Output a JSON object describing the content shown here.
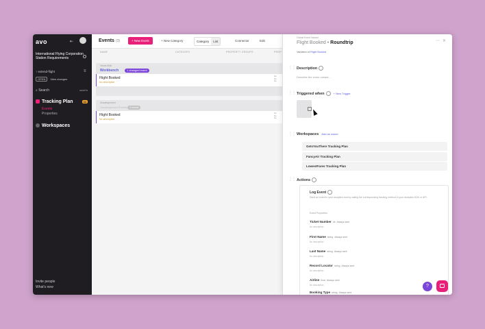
{
  "sidebar": {
    "logo": "avo",
    "workspace_name": "International Flying Corporation Station Requirements",
    "branch": "↑ extend-flight",
    "branch_tags": [
      "OPEN",
      "View changes"
    ],
    "search": "Search",
    "search_kbd": "cmd+k",
    "tracking_plan": "Tracking Plan",
    "tracking_badge": "34",
    "items": [
      {
        "label": "Events"
      },
      {
        "label": "Properties"
      }
    ],
    "workspaces": "Workspaces",
    "invite": "Invite people",
    "whats_new": "What's new"
  },
  "topbar": {
    "title": "Events",
    "count": "(3)",
    "new_event": "+ New Event",
    "new_category": "+ New Category",
    "seg": [
      "Category",
      "List"
    ],
    "connect": "Connector",
    "edit": "Edit"
  },
  "columns": [
    "NAME",
    "CATEGORY",
    "PROPERTY GROUPS",
    "PROP"
  ],
  "groups": [
    {
      "pre": "Views Bulk",
      "name": "Workbench",
      "pill": "1 changed event",
      "event": {
        "name": "Flight Booked",
        "desc": "No description"
      }
    },
    {
      "pre": "Uncategorized",
      "name": "Uncategorized Events",
      "pill": "1 event",
      "event": {
        "name": "Flight Booked",
        "desc": "No description"
      }
    }
  ],
  "panel": {
    "crumb": "Global Event Variant",
    "title_base": "Flight Booked",
    "title_variant": "Roundtrip",
    "variant_of_prefix": "Variation of",
    "variant_of": "Flight Booked",
    "description_label": "Description",
    "description_placeholder": "Describe the event variant...",
    "triggered_label": "Triggered when",
    "new_trigger": "+ New Trigger",
    "workspaces_label": "Workspaces",
    "workspaces_link": "Add as owner",
    "workspaces": [
      "GetsYouThere Tracking Plan",
      "FancyAir Tracking Plan",
      "LowestFares Tracking Plan"
    ],
    "actions_label": "Actions",
    "log_event": "Log Event",
    "log_desc": "Send an event to your analytics tool by calling the corresponding tracking method in your analytics SDK or API.",
    "event_props_label": "Event Properties",
    "props": [
      {
        "name": "Ticket Number",
        "type": "int",
        "ph": "Always sent",
        "desc": "No description"
      },
      {
        "name": "First Name",
        "type": "string",
        "ph": "Always sent",
        "desc": "No description"
      },
      {
        "name": "Last Name",
        "type": "string",
        "ph": "Always sent",
        "desc": "No description"
      },
      {
        "name": "Record Locator",
        "type": "string",
        "ph": "Always sent",
        "desc": "No description"
      },
      {
        "name": "Airline",
        "type": "float",
        "ph": "Always sent",
        "desc": "No description"
      },
      {
        "name": "Booking Type",
        "type": "string",
        "ph": "Always sent",
        "desc": ""
      }
    ]
  },
  "fab_help": "?",
  "colors": {
    "accent": "#e9207a",
    "purple": "#7a45d8",
    "sidebar": "#1f1d22"
  }
}
